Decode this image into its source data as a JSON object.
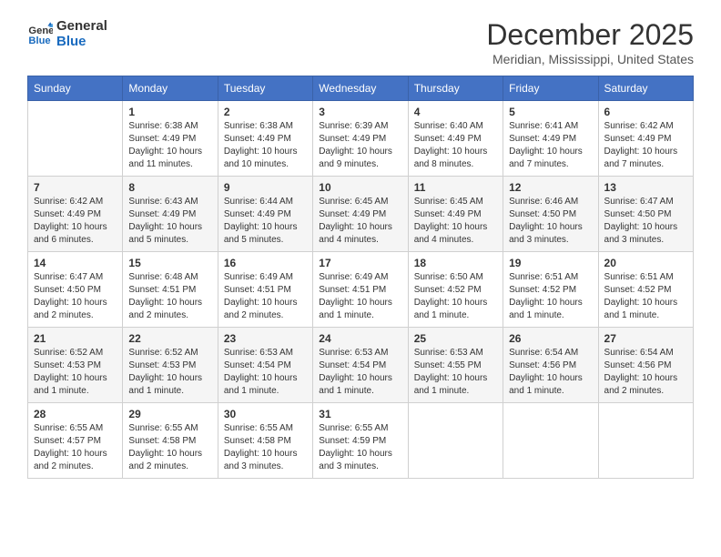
{
  "header": {
    "logo_line1": "General",
    "logo_line2": "Blue",
    "month_title": "December 2025",
    "location": "Meridian, Mississippi, United States"
  },
  "days_of_week": [
    "Sunday",
    "Monday",
    "Tuesday",
    "Wednesday",
    "Thursday",
    "Friday",
    "Saturday"
  ],
  "weeks": [
    [
      {
        "day": "",
        "info": ""
      },
      {
        "day": "1",
        "info": "Sunrise: 6:38 AM\nSunset: 4:49 PM\nDaylight: 10 hours\nand 11 minutes."
      },
      {
        "day": "2",
        "info": "Sunrise: 6:38 AM\nSunset: 4:49 PM\nDaylight: 10 hours\nand 10 minutes."
      },
      {
        "day": "3",
        "info": "Sunrise: 6:39 AM\nSunset: 4:49 PM\nDaylight: 10 hours\nand 9 minutes."
      },
      {
        "day": "4",
        "info": "Sunrise: 6:40 AM\nSunset: 4:49 PM\nDaylight: 10 hours\nand 8 minutes."
      },
      {
        "day": "5",
        "info": "Sunrise: 6:41 AM\nSunset: 4:49 PM\nDaylight: 10 hours\nand 7 minutes."
      },
      {
        "day": "6",
        "info": "Sunrise: 6:42 AM\nSunset: 4:49 PM\nDaylight: 10 hours\nand 7 minutes."
      }
    ],
    [
      {
        "day": "7",
        "info": "Sunrise: 6:42 AM\nSunset: 4:49 PM\nDaylight: 10 hours\nand 6 minutes."
      },
      {
        "day": "8",
        "info": "Sunrise: 6:43 AM\nSunset: 4:49 PM\nDaylight: 10 hours\nand 5 minutes."
      },
      {
        "day": "9",
        "info": "Sunrise: 6:44 AM\nSunset: 4:49 PM\nDaylight: 10 hours\nand 5 minutes."
      },
      {
        "day": "10",
        "info": "Sunrise: 6:45 AM\nSunset: 4:49 PM\nDaylight: 10 hours\nand 4 minutes."
      },
      {
        "day": "11",
        "info": "Sunrise: 6:45 AM\nSunset: 4:49 PM\nDaylight: 10 hours\nand 4 minutes."
      },
      {
        "day": "12",
        "info": "Sunrise: 6:46 AM\nSunset: 4:50 PM\nDaylight: 10 hours\nand 3 minutes."
      },
      {
        "day": "13",
        "info": "Sunrise: 6:47 AM\nSunset: 4:50 PM\nDaylight: 10 hours\nand 3 minutes."
      }
    ],
    [
      {
        "day": "14",
        "info": "Sunrise: 6:47 AM\nSunset: 4:50 PM\nDaylight: 10 hours\nand 2 minutes."
      },
      {
        "day": "15",
        "info": "Sunrise: 6:48 AM\nSunset: 4:51 PM\nDaylight: 10 hours\nand 2 minutes."
      },
      {
        "day": "16",
        "info": "Sunrise: 6:49 AM\nSunset: 4:51 PM\nDaylight: 10 hours\nand 2 minutes."
      },
      {
        "day": "17",
        "info": "Sunrise: 6:49 AM\nSunset: 4:51 PM\nDaylight: 10 hours\nand 1 minute."
      },
      {
        "day": "18",
        "info": "Sunrise: 6:50 AM\nSunset: 4:52 PM\nDaylight: 10 hours\nand 1 minute."
      },
      {
        "day": "19",
        "info": "Sunrise: 6:51 AM\nSunset: 4:52 PM\nDaylight: 10 hours\nand 1 minute."
      },
      {
        "day": "20",
        "info": "Sunrise: 6:51 AM\nSunset: 4:52 PM\nDaylight: 10 hours\nand 1 minute."
      }
    ],
    [
      {
        "day": "21",
        "info": "Sunrise: 6:52 AM\nSunset: 4:53 PM\nDaylight: 10 hours\nand 1 minute."
      },
      {
        "day": "22",
        "info": "Sunrise: 6:52 AM\nSunset: 4:53 PM\nDaylight: 10 hours\nand 1 minute."
      },
      {
        "day": "23",
        "info": "Sunrise: 6:53 AM\nSunset: 4:54 PM\nDaylight: 10 hours\nand 1 minute."
      },
      {
        "day": "24",
        "info": "Sunrise: 6:53 AM\nSunset: 4:54 PM\nDaylight: 10 hours\nand 1 minute."
      },
      {
        "day": "25",
        "info": "Sunrise: 6:53 AM\nSunset: 4:55 PM\nDaylight: 10 hours\nand 1 minute."
      },
      {
        "day": "26",
        "info": "Sunrise: 6:54 AM\nSunset: 4:56 PM\nDaylight: 10 hours\nand 1 minute."
      },
      {
        "day": "27",
        "info": "Sunrise: 6:54 AM\nSunset: 4:56 PM\nDaylight: 10 hours\nand 2 minutes."
      }
    ],
    [
      {
        "day": "28",
        "info": "Sunrise: 6:55 AM\nSunset: 4:57 PM\nDaylight: 10 hours\nand 2 minutes."
      },
      {
        "day": "29",
        "info": "Sunrise: 6:55 AM\nSunset: 4:58 PM\nDaylight: 10 hours\nand 2 minutes."
      },
      {
        "day": "30",
        "info": "Sunrise: 6:55 AM\nSunset: 4:58 PM\nDaylight: 10 hours\nand 3 minutes."
      },
      {
        "day": "31",
        "info": "Sunrise: 6:55 AM\nSunset: 4:59 PM\nDaylight: 10 hours\nand 3 minutes."
      },
      {
        "day": "",
        "info": ""
      },
      {
        "day": "",
        "info": ""
      },
      {
        "day": "",
        "info": ""
      }
    ]
  ]
}
